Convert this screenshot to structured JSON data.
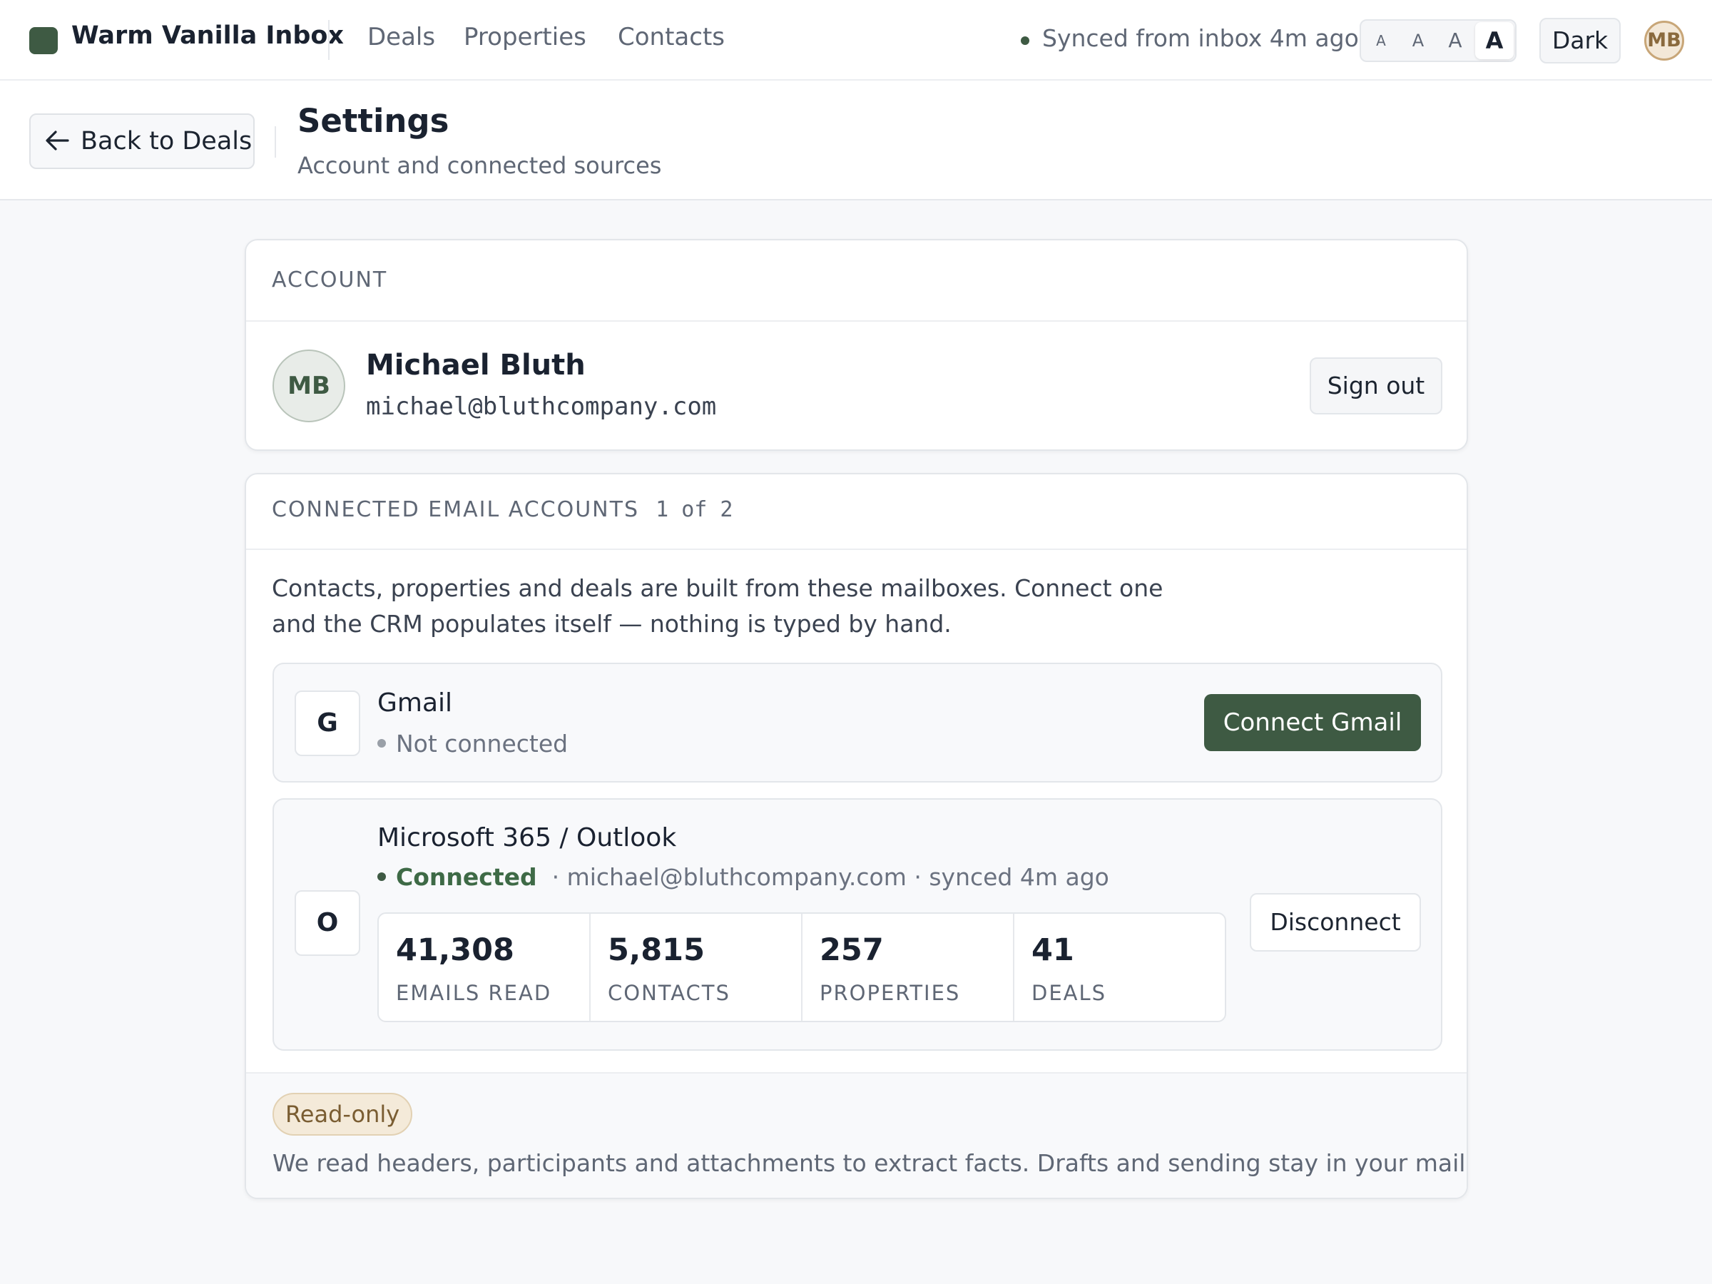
{
  "app": {
    "name": "Warm Vanilla Inbox",
    "nav": [
      "Deals",
      "Properties",
      "Contacts"
    ],
    "sync_status": "Synced from inbox 4m ago",
    "text_sizes": [
      "A",
      "A",
      "A",
      "A"
    ],
    "selected_text_size_index": 3,
    "theme_toggle": "Dark",
    "user_initials": "MB",
    "brand_color": "#3e5a43"
  },
  "subheader": {
    "back_label": "Back to Deals",
    "title": "Settings",
    "subtitle": "Account and connected sources"
  },
  "account": {
    "section_label": "ACCOUNT",
    "initials": "MB",
    "name": "Michael Bluth",
    "email": "michael@bluthcompany.com",
    "sign_out": "Sign out"
  },
  "email_accounts": {
    "section_label": "CONNECTED EMAIL ACCOUNTS",
    "count": "1 of 2",
    "intro": "Contacts, properties and deals are built from these mailboxes. Connect one and the CRM populates itself — nothing is typed by hand.",
    "providers": [
      {
        "badge": "G",
        "name": "Gmail",
        "status": "Not connected",
        "action": "Connect Gmail"
      },
      {
        "badge": "O",
        "name": "Microsoft 365 / Outlook",
        "status": "Connected",
        "detail": "· michael@bluthcompany.com · synced 4m ago",
        "action": "Disconnect",
        "stats": [
          {
            "value": "41,308",
            "label": "EMAILS READ"
          },
          {
            "value": "5,815",
            "label": "CONTACTS"
          },
          {
            "value": "257",
            "label": "PROPERTIES"
          },
          {
            "value": "41",
            "label": "DEALS"
          }
        ]
      }
    ],
    "read_only_badge": "Read-only",
    "read_only_note": "We read headers, participants and attachments to extract facts. Drafts and sending stay in your mailbox."
  }
}
